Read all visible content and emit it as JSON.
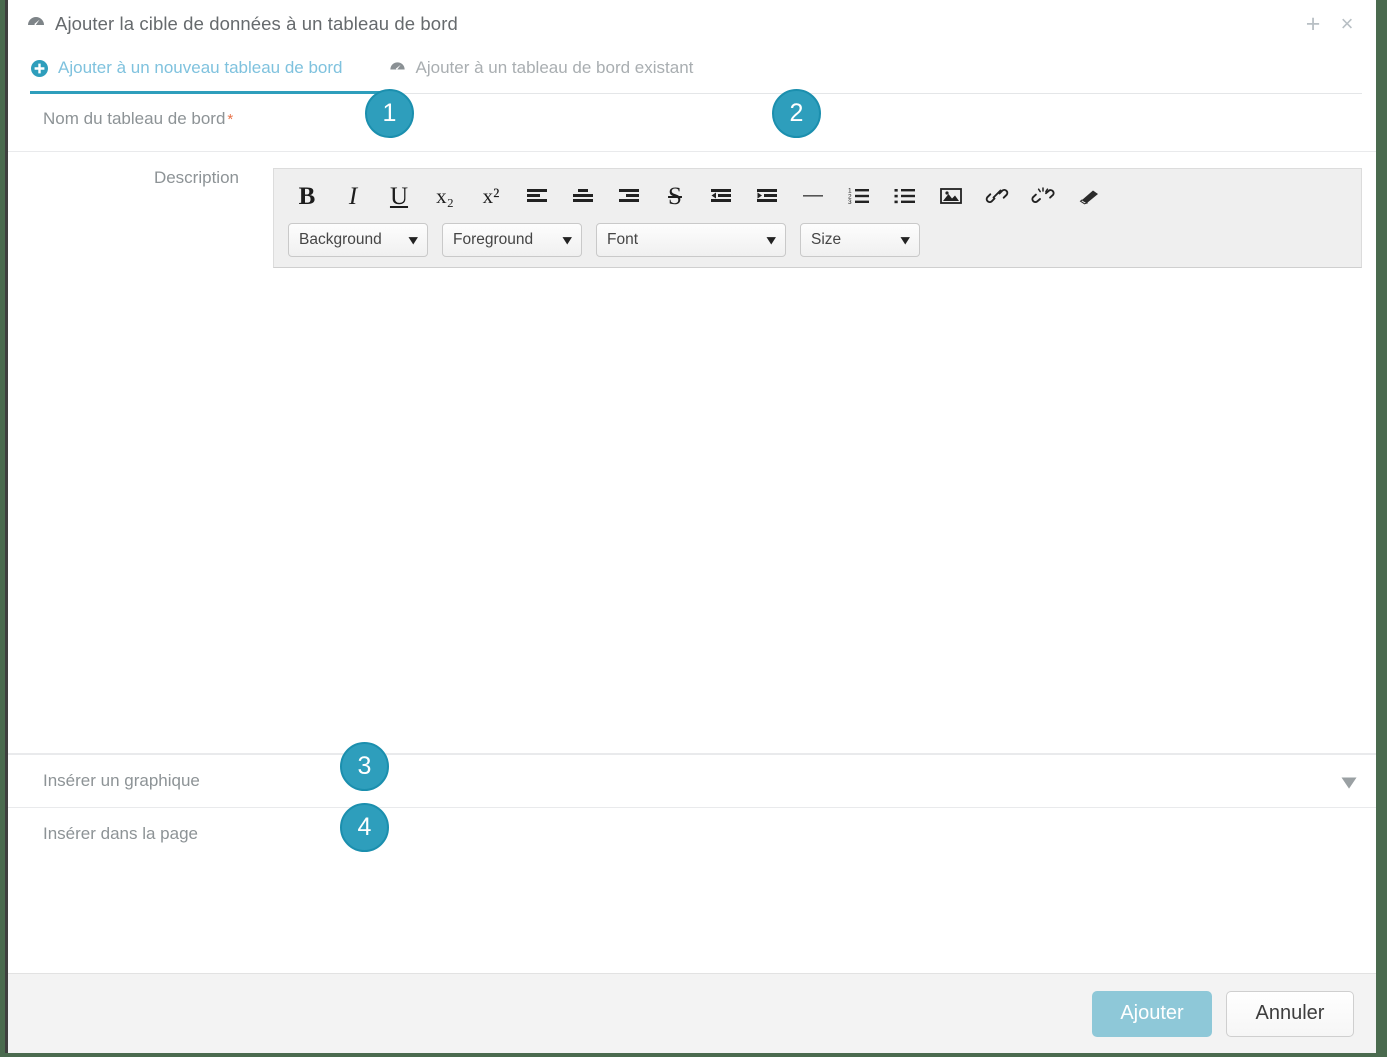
{
  "window": {
    "title": "Ajouter la cible de données à un tableau de bord",
    "title_icon": "dashboard-gauge-icon",
    "maximize_label": "+",
    "close_label": "×"
  },
  "tabs": [
    {
      "label": "Ajouter à un nouveau tableau de bord",
      "icon": "plus-circle-icon",
      "active": true
    },
    {
      "label": "Ajouter à un tableau de bord existant",
      "icon": "dashboard-gauge-icon",
      "active": false
    }
  ],
  "form": {
    "name_label": "Nom du tableau de bord",
    "name_required_mark": "*",
    "name_value": "",
    "name_placeholder": "",
    "description_label": "Description",
    "description_value": "",
    "insert_chart_label": "Insérer un graphique",
    "insert_in_page_label": "Insérer dans la page"
  },
  "editor": {
    "buttons": [
      {
        "name": "bold-icon",
        "glyph": "B"
      },
      {
        "name": "italic-icon",
        "glyph": "I"
      },
      {
        "name": "underline-icon",
        "glyph": "U"
      },
      {
        "name": "subscript-icon",
        "glyph": "x₂"
      },
      {
        "name": "superscript-icon",
        "glyph": "x²"
      },
      {
        "name": "align-left-icon",
        "glyph": ""
      },
      {
        "name": "align-center-icon",
        "glyph": ""
      },
      {
        "name": "align-right-icon",
        "glyph": ""
      },
      {
        "name": "strikethrough-icon",
        "glyph": "S"
      },
      {
        "name": "indent-decrease-icon",
        "glyph": ""
      },
      {
        "name": "indent-increase-icon",
        "glyph": ""
      },
      {
        "name": "horizontal-rule-icon",
        "glyph": "—"
      },
      {
        "name": "ordered-list-icon",
        "glyph": ""
      },
      {
        "name": "unordered-list-icon",
        "glyph": ""
      },
      {
        "name": "insert-image-icon",
        "glyph": ""
      },
      {
        "name": "insert-link-icon",
        "glyph": ""
      },
      {
        "name": "remove-link-icon",
        "glyph": ""
      },
      {
        "name": "clear-format-eraser-icon",
        "glyph": ""
      }
    ],
    "selects": [
      {
        "name": "background-color-select",
        "label": "Background"
      },
      {
        "name": "foreground-color-select",
        "label": "Foreground"
      },
      {
        "name": "font-family-select",
        "label": "Font"
      },
      {
        "name": "font-size-select",
        "label": "Size"
      }
    ],
    "caret": "⌄"
  },
  "footer": {
    "submit_label": "Ajouter",
    "cancel_label": "Annuler"
  },
  "callouts": [
    {
      "number": "1"
    },
    {
      "number": "2"
    },
    {
      "number": "3"
    },
    {
      "number": "4"
    }
  ],
  "colors": {
    "accent_teal": "#2e9ebc",
    "tab_active_text": "#7fc2de",
    "primary_button": "#8ec8d8",
    "required_star": "#e8734a",
    "page_background": "#4a6a4e"
  }
}
